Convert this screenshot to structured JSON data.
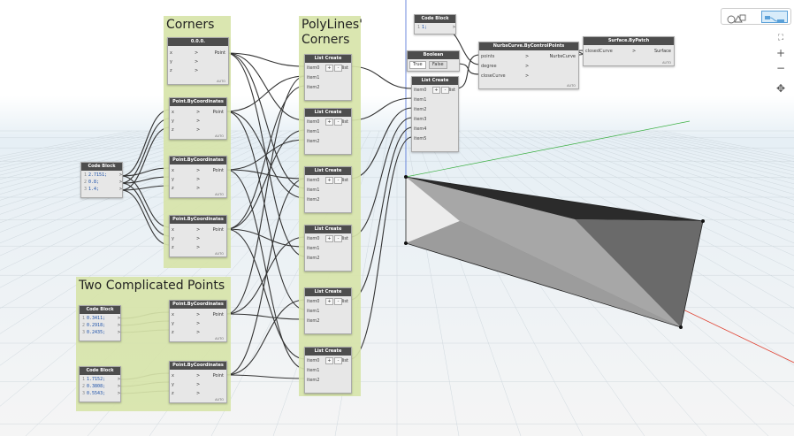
{
  "groups": {
    "corners": "Corners",
    "polylines": "PolyLines'\nCorners",
    "complicated": "Two Complicated Points"
  },
  "nodes": {
    "origin": {
      "title": "0.0.0.",
      "badge": "Preview",
      "inputs": [
        "x",
        "y",
        "z"
      ],
      "output": "Point",
      "foot": "AUTO"
    },
    "pbc": {
      "title": "Point.ByCoordinates",
      "inputs": [
        "x",
        "y",
        "z"
      ],
      "output": "Point",
      "foot": "AUTO"
    },
    "code_main": {
      "title": "Code Block",
      "lines": [
        "2.7151;",
        "0.8;",
        "1.4;"
      ]
    },
    "code_c1": {
      "title": "Code Block",
      "lines": [
        "0.3411;",
        "0.2918;",
        "0.2435;"
      ]
    },
    "code_c2": {
      "title": "Code Block",
      "lines": [
        "1.7152;",
        "0.3808;",
        "0.5543;"
      ]
    },
    "code_top": {
      "title": "Code Block",
      "lines": [
        "1;"
      ]
    },
    "list_create": {
      "title": "List Create",
      "items": [
        "item0",
        "item1",
        "item2"
      ],
      "add": "+",
      "remove": "-",
      "output": "list"
    },
    "list_create5": {
      "title": "List Create",
      "items": [
        "item0",
        "item1",
        "item2",
        "item3",
        "item4",
        "item5"
      ],
      "add": "+",
      "remove": "-",
      "output": "list"
    },
    "boolean": {
      "title": "Boolean",
      "true_label": "True",
      "false_label": "False"
    },
    "nurbs": {
      "title": "NurbsCurve.ByControlPoints",
      "inputs": [
        "points",
        "degree",
        "closeCurve"
      ],
      "output": "NurbsCurve",
      "foot": "AUTO"
    },
    "surface": {
      "title": "Surface.ByPatch",
      "inputs": [
        "closedCurve"
      ],
      "output": "Surface",
      "foot": "AUTO"
    }
  },
  "toolbar": {
    "icon1": "shapes-3d-icon",
    "icon2": "graph-view-icon"
  },
  "zoom": {
    "fit": "⛶",
    "plus": "+",
    "minus": "−",
    "pan": "✥"
  },
  "colors": {
    "group": "#d7e4a9",
    "node_header": "#4d4d4d",
    "wire": "#333333",
    "surface_dark": "#2a2a2a"
  }
}
